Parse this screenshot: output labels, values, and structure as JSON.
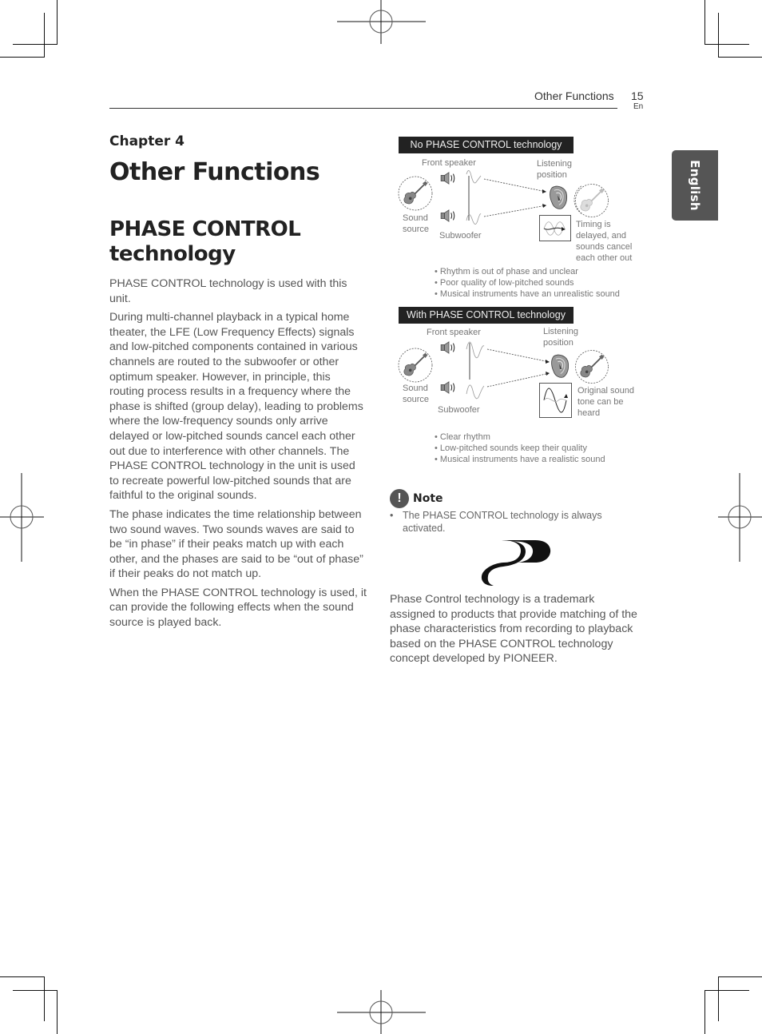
{
  "header": {
    "section_title": "Other Functions",
    "page_number": "15",
    "language_code": "En"
  },
  "side_tab": {
    "label": "English"
  },
  "chapter": {
    "label": "Chapter 4",
    "title": "Other Functions"
  },
  "section": {
    "title": "PHASE CONTROL technology",
    "paragraphs": [
      "PHASE CONTROL technology is used with this unit.",
      "During multi-channel playback in a typical home theater, the LFE (Low Frequency Effects) signals and low-pitched components contained in various channels are routed to the subwoofer or other optimum speaker. However, in principle, this routing process results in a frequency where the phase is shifted (group delay), leading to problems where the low-frequency sounds only arrive delayed or low-pitched sounds cancel each other out due to interference with other channels. The PHASE CONTROL technology in the unit is used to recreate powerful low-pitched sounds that are faithful to the original sounds.",
      "The phase indicates the time relationship between two sound waves. Two sounds waves are said to be “in phase” if their peaks match up with each other, and the phases are said to be “out of phase” if their peaks do not match up.",
      "When the PHASE CONTROL technology is used, it can provide the following effects when the sound source is played back."
    ]
  },
  "diagrams": [
    {
      "title": "No PHASE CONTROL technology",
      "front_speaker": "Front speaker",
      "listening_position": "Listening position",
      "sound_source": "Sound source",
      "subwoofer": "Subwoofer",
      "result": "Timing is delayed, and sounds cancel each other out",
      "bullets": [
        "Rhythm is out of phase and unclear",
        "Poor quality of low-pitched sounds",
        "Musical instruments have an unrealistic sound"
      ]
    },
    {
      "title": "With PHASE CONTROL technology",
      "front_speaker": "Front speaker",
      "listening_position": "Listening position",
      "sound_source": "Sound source",
      "subwoofer": "Subwoofer",
      "result": "Original sound tone can be heard",
      "bullets": [
        "Clear rhythm",
        "Low-pitched sounds keep their quality",
        "Musical instruments have a realistic sound"
      ]
    }
  ],
  "note": {
    "icon": "exclamation-icon",
    "label": "Note",
    "items": [
      "The PHASE CONTROL technology is always activated."
    ]
  },
  "trademark": {
    "logo": "phase-control-logo",
    "text": "Phase Control technology is a trademark assigned to products that provide matching of the phase characteristics from recording to playback based on the PHASE CONTROL technology concept developed by PIONEER."
  }
}
